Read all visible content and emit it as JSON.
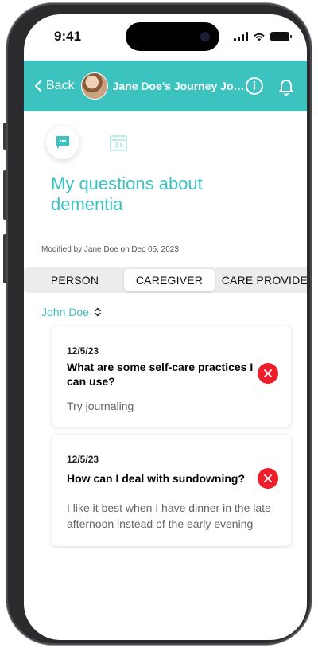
{
  "status_bar": {
    "time": "9:41"
  },
  "header": {
    "back_label": "Back",
    "title": "Jane Doe's Journey Jour..."
  },
  "page": {
    "title": "My questions about dementia",
    "modified": "Modified by Jane Doe on Dec 05, 2023"
  },
  "tabs": [
    {
      "label": "PERSON"
    },
    {
      "label": "CAREGIVER"
    },
    {
      "label": "CARE PROVIDER"
    }
  ],
  "selected_tab": "CAREGIVER",
  "person_select": {
    "value": "John Doe"
  },
  "questions": [
    {
      "date": "12/5/23",
      "question": "What are some self-care practices I can use?",
      "answer": "Try journaling"
    },
    {
      "date": "12/5/23",
      "question": "How can I deal with sundowning?",
      "answer": "I like it best when I have dinner in the late afternoon instead of the early evening"
    }
  ],
  "colors": {
    "accent": "#3cc2bf",
    "delete": "#ec1f2a",
    "tab_bg": "#ececee"
  },
  "icons": {
    "header": [
      "info-icon",
      "bell-icon"
    ],
    "modes": [
      "chat-icon",
      "calendar-icon"
    ]
  }
}
